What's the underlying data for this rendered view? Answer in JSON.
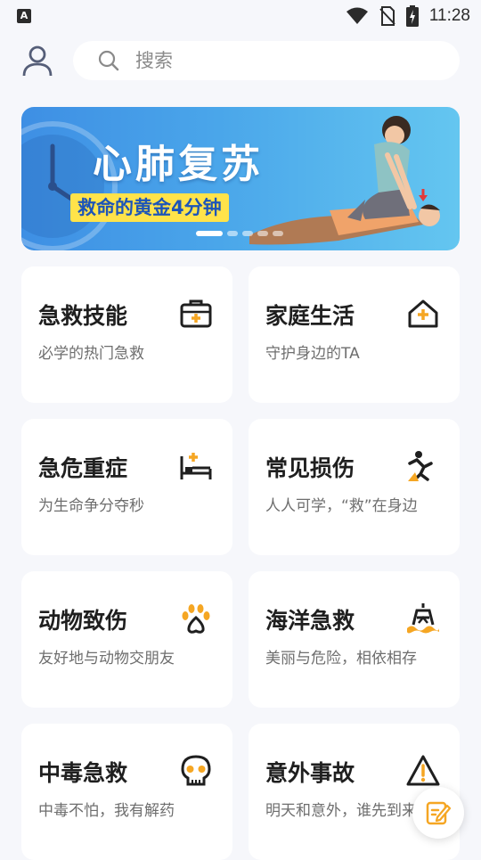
{
  "status_bar": {
    "time": "11:28"
  },
  "search": {
    "placeholder": "搜索"
  },
  "banner": {
    "title": "心肺复苏",
    "subtitle": "救命的黄金4分钟",
    "dot_count": 5,
    "active_dot": 0
  },
  "cards": [
    {
      "title": "急救技能",
      "subtitle": "必学的热门急救",
      "icon": "first-aid-kit-icon"
    },
    {
      "title": "家庭生活",
      "subtitle": "守护身边的TA",
      "icon": "house-plus-icon"
    },
    {
      "title": "急危重症",
      "subtitle": "为生命争分夺秒",
      "icon": "hospital-bed-icon"
    },
    {
      "title": "常见损伤",
      "subtitle": "人人可学，“救”在身边",
      "icon": "falling-person-icon"
    },
    {
      "title": "动物致伤",
      "subtitle": "友好地与动物交朋友",
      "icon": "paw-icon"
    },
    {
      "title": "海洋急救",
      "subtitle": "美丽与危险，相依相存",
      "icon": "buoy-waves-icon"
    },
    {
      "title": "中毒急救",
      "subtitle": "中毒不怕，我有解药",
      "icon": "skull-icon"
    },
    {
      "title": "意外事故",
      "subtitle": "明天和意外，谁先到来",
      "icon": "warning-triangle-icon"
    }
  ],
  "colors": {
    "accent": "#f5a623",
    "background": "#f6f7fb",
    "banner_blue": "#3e8fe4",
    "banner_yellow": "#ffe34a"
  }
}
